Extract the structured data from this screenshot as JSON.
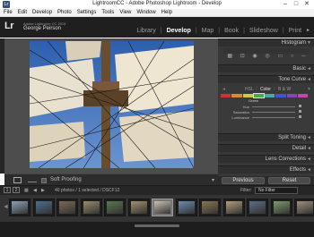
{
  "window": {
    "title": "LightroomCC - Adobe Photoshop Lightroom - Develop",
    "min": "–",
    "max": "□",
    "close": "✕"
  },
  "menu": [
    "File",
    "Edit",
    "Develop",
    "Photo",
    "Settings",
    "Tools",
    "View",
    "Window",
    "Help"
  ],
  "identity": {
    "logo": "Lr",
    "subtitle": "Adobe Lightroom CC 2015",
    "name": "George Peirson"
  },
  "modules": [
    "Library",
    "Develop",
    "Map",
    "Book",
    "Slideshow",
    "Print"
  ],
  "modules_sep": "|",
  "modules_more": "►",
  "right_panel": {
    "histogram": "Histogram",
    "basic": "Basic",
    "tone_curve": "Tone Curve",
    "hsl_tabs": {
      "hsl": "HSL",
      "slash1": "/",
      "color": "Color",
      "slash2": "/",
      "bw": "B & W"
    },
    "green": "Green",
    "sliders": [
      "Hue",
      "Saturation",
      "Luminance"
    ],
    "split_toning": "Split Toning",
    "detail": "Detail",
    "lens_corrections": "Lens Corrections",
    "effects": "Effects"
  },
  "toolbar": {
    "soft_proofing": "Soft Proofing",
    "chev": "▾"
  },
  "buttons": {
    "previous": "Previous",
    "reset": "Reset"
  },
  "filmbar": {
    "num1": "1",
    "num2": "2",
    "path": "40 photos / 1 selected / DSCF12",
    "filter_label": "Filter:",
    "filter_value": "No Filter"
  },
  "icons": {
    "tri_left": "◄",
    "tri_down": "▼",
    "arrow_left": "◀",
    "arrow_right": "▶"
  }
}
